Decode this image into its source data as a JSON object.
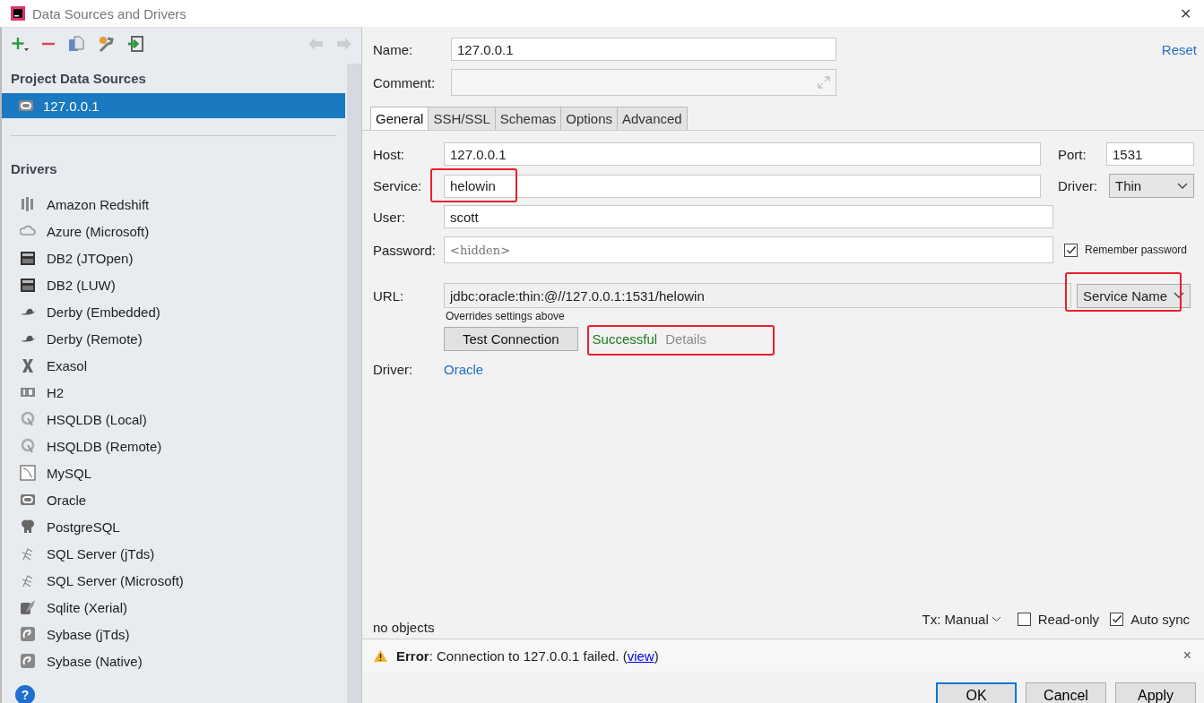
{
  "window": {
    "title": "Data Sources and Drivers",
    "close": "✕"
  },
  "toolbar": {
    "nav": [
      {
        "kind": "back",
        "disabled": true
      },
      {
        "kind": "forward",
        "disabled": true
      }
    ]
  },
  "sidebar": {
    "project_heading": "Project Data Sources",
    "sources": [
      {
        "label": "127.0.0.1",
        "selected": true
      }
    ],
    "drivers_heading": "Drivers",
    "drivers": [
      {
        "label": "Amazon Redshift",
        "kind": "redshift"
      },
      {
        "label": "Azure (Microsoft)",
        "kind": "azure"
      },
      {
        "label": "DB2 (JTOpen)",
        "kind": "db2"
      },
      {
        "label": "DB2 (LUW)",
        "kind": "db2"
      },
      {
        "label": "Derby (Embedded)",
        "kind": "derby"
      },
      {
        "label": "Derby (Remote)",
        "kind": "derby"
      },
      {
        "label": "Exasol",
        "kind": "exasol"
      },
      {
        "label": "H2",
        "kind": "h2"
      },
      {
        "label": "HSQLDB (Local)",
        "kind": "hsqldb"
      },
      {
        "label": "HSQLDB (Remote)",
        "kind": "hsqldb"
      },
      {
        "label": "MySQL",
        "kind": "mysql"
      },
      {
        "label": "Oracle",
        "kind": "oracle"
      },
      {
        "label": "PostgreSQL",
        "kind": "postgres"
      },
      {
        "label": "SQL Server (jTds)",
        "kind": "sqlserver"
      },
      {
        "label": "SQL Server (Microsoft)",
        "kind": "sqlserver"
      },
      {
        "label": "Sqlite (Xerial)",
        "kind": "sqlite"
      },
      {
        "label": "Sybase (jTds)",
        "kind": "sybase"
      },
      {
        "label": "Sybase (Native)",
        "kind": "sybase"
      }
    ],
    "help": "?"
  },
  "header": {
    "name_label": "Name:",
    "name_value": "127.0.0.1",
    "reset": "Reset",
    "comment_label": "Comment:"
  },
  "tabs": [
    {
      "label": "General",
      "selected": true
    },
    {
      "label": "SSH/SSL",
      "selected": false
    },
    {
      "label": "Schemas",
      "selected": false
    },
    {
      "label": "Options",
      "selected": false
    },
    {
      "label": "Advanced",
      "selected": false
    }
  ],
  "general": {
    "host": {
      "label": "Host:",
      "value": "127.0.0.1"
    },
    "port": {
      "label": "Port:",
      "value": "1531"
    },
    "service": {
      "label": "Service:",
      "value": "helowin",
      "annotated": true
    },
    "driver_type": {
      "label": "Driver:",
      "value": "Thin"
    },
    "user": {
      "label": "User:",
      "value": "scott"
    },
    "password": {
      "label": "Password:",
      "placeholder": "<hidden>"
    },
    "remember": {
      "label": "Remember password",
      "checked": true
    },
    "url": {
      "label": "URL:",
      "value": "jdbc:oracle:thin:@//127.0.0.1:1531/helowin",
      "hint": "Overrides settings above"
    },
    "url_type": {
      "value": "Service Name",
      "annotated": true
    },
    "test_button": "Test Connection",
    "test_result": {
      "status": "Successful",
      "details": "Details",
      "annotated": true
    },
    "driver": {
      "label": "Driver:",
      "value": "Oracle"
    }
  },
  "status": {
    "objects": "no objects",
    "tx": "Tx: Manual",
    "read_only": {
      "label": "Read-only",
      "checked": false
    },
    "auto_sync": {
      "label": "Auto sync",
      "checked": true
    }
  },
  "error": {
    "label": "Error",
    "message": ": Connection to 127.0.0.1 failed. (",
    "link": "view",
    "end": ")",
    "close": "×"
  },
  "buttons": [
    {
      "label": "OK",
      "default": true
    },
    {
      "label": "Cancel",
      "default": false
    },
    {
      "label": "Apply",
      "default": false
    }
  ]
}
